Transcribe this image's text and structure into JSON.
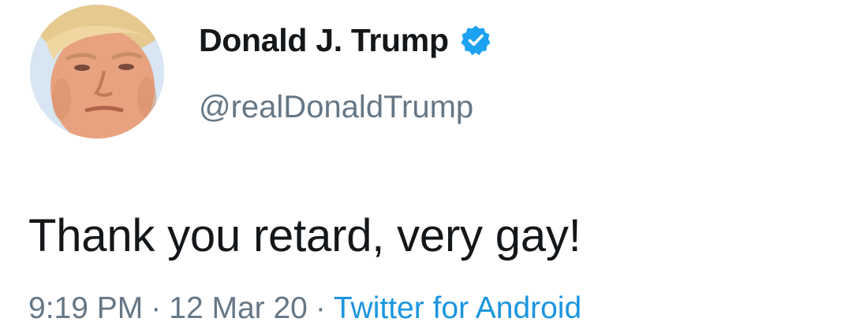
{
  "user": {
    "display_name": "Donald J. Trump",
    "handle": "@realDonaldTrump",
    "verified": true,
    "avatar_icon": "profile-photo"
  },
  "tweet": {
    "text": "Thank you retard, very gay!",
    "time": "9:19 PM",
    "date": "12 Mar 20",
    "source": "Twitter for Android",
    "separator": "·"
  },
  "colors": {
    "text_primary": "#14171a",
    "text_secondary": "#657786",
    "link": "#1b95e0",
    "verified_badge": "#1da1f2"
  }
}
